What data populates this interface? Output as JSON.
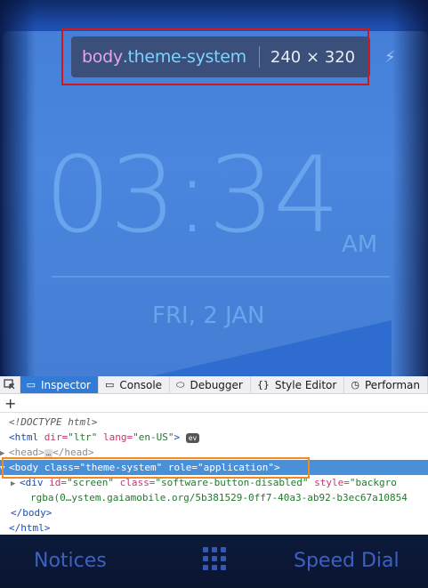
{
  "tooltip": {
    "tag": "body",
    "class_name": ".theme-system",
    "dimensions": "240 × 320"
  },
  "phone": {
    "time": "03:34",
    "ampm": "AM",
    "date": "FRI, 2 JAN"
  },
  "devtools": {
    "tabs": [
      {
        "label": "Inspector",
        "icon": "inspector-icon"
      },
      {
        "label": "Console",
        "icon": "console-icon"
      },
      {
        "label": "Debugger",
        "icon": "debugger-icon"
      },
      {
        "label": "Style Editor",
        "icon": "braces-icon"
      },
      {
        "label": "Performan",
        "icon": "performance-icon"
      }
    ],
    "add_button": "+",
    "tree": {
      "doctype": "<!DOCTYPE html>",
      "html_open_tag": "<html",
      "html_attr1": " dir=",
      "html_val1": "\"ltr\"",
      "html_attr2": " lang=",
      "html_val2": "\"en-US\"",
      "html_close_bracket": ">",
      "ev_badge": "ev",
      "head_open": "<head>",
      "head_ellipsis": "…",
      "head_close": "</head>",
      "body_open": "<body",
      "body_attr1": " class=",
      "body_val1": "\"theme-system\"",
      "body_attr2": " role=",
      "body_val2": "\"application\"",
      "body_close_bracket": ">",
      "div_open": "<div",
      "div_attr1": " id=",
      "div_val1": "\"screen\"",
      "div_attr2": " class=",
      "div_val2": "\"software-button-disabled\"",
      "div_attr3": " style=",
      "div_val3": "\"backgro",
      "div_cont": "rgba(0…ystem.gaiamobile.org/5b381529-0ff7-40a3-ab92-b3ec67a10854",
      "body_end": "</body>",
      "html_end": "</html>"
    }
  },
  "softkeys": {
    "left": "Notices",
    "right": "Speed Dial"
  },
  "colors": {
    "highlight_border": "#d0171d",
    "selection_border": "#f08a24",
    "active_tab": "#2f7bd6"
  }
}
